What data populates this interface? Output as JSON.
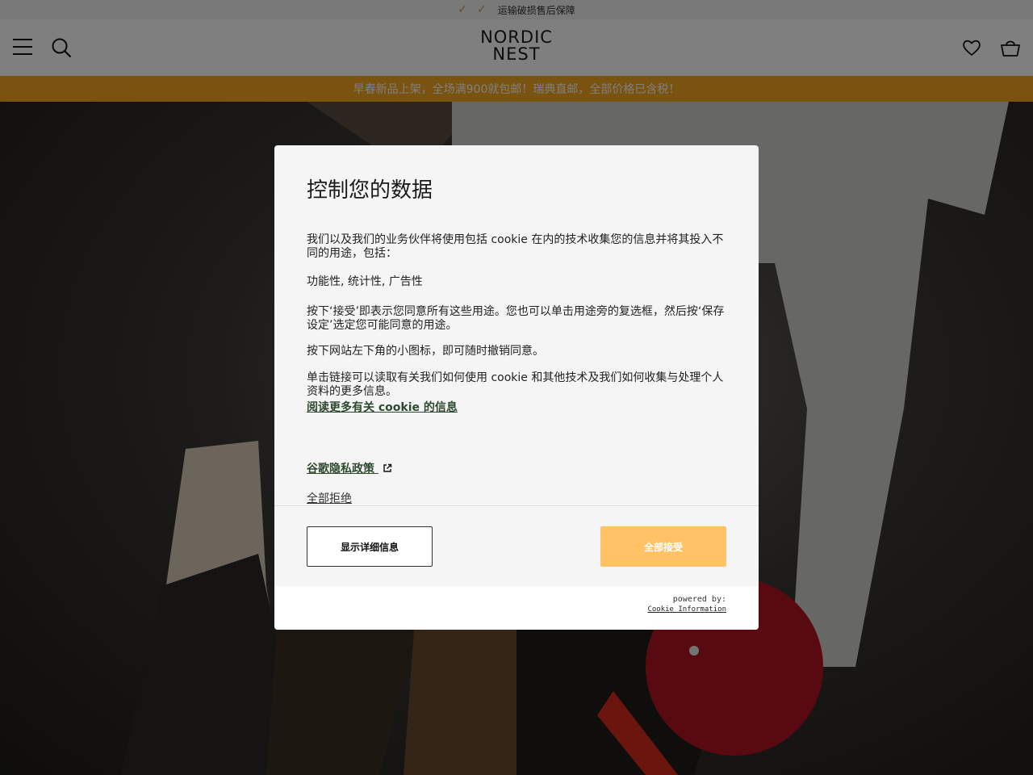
{
  "topbar": {
    "check_icon": "check-icon",
    "text": "运输破损售后保障"
  },
  "header": {
    "logo_line1": "NORDIC",
    "logo_line2": "NEST",
    "menu_icon": "hamburger-icon",
    "search_icon": "search-icon",
    "wishlist_icon": "heart-icon",
    "cart_icon": "basket-icon"
  },
  "promo": {
    "text": "早春新品上架，全场满900就包邮！瑞典直邮，全部价格已含税！",
    "color": "#f5a623"
  },
  "modal": {
    "title": "控制您的数据",
    "p1": "我们以及我们的业务伙伴将使用包括 cookie 在内的技术收集您的信息并将其投入不同的用途，包括：",
    "p2": "功能性, 统计性, 广告性",
    "p3": "按下‘接受’即表示您同意所有这些用途。您也可以单击用途旁的复选框，然后按‘保存设定’选定您可能同意的用途。",
    "p4": "按下网站左下角的小图标，即可随时撤销同意。",
    "p5": "单击链接可以读取有关我们如何使用 cookie 和其他技术及我们如何收集与处理个人资料的更多信息。",
    "link_cookie": "阅读更多有关 cookie 的信息",
    "link_google": "谷歌隐私政策",
    "external_icon": "external-link-icon",
    "link_reject": "全部拒绝",
    "btn_details": "显示详细信息",
    "btn_accept": "全部接受",
    "powered_by": "powered by:",
    "powered_brand": "Cookie Information",
    "accent_color": "#ffc266",
    "link_color": "#2e4a2e"
  }
}
